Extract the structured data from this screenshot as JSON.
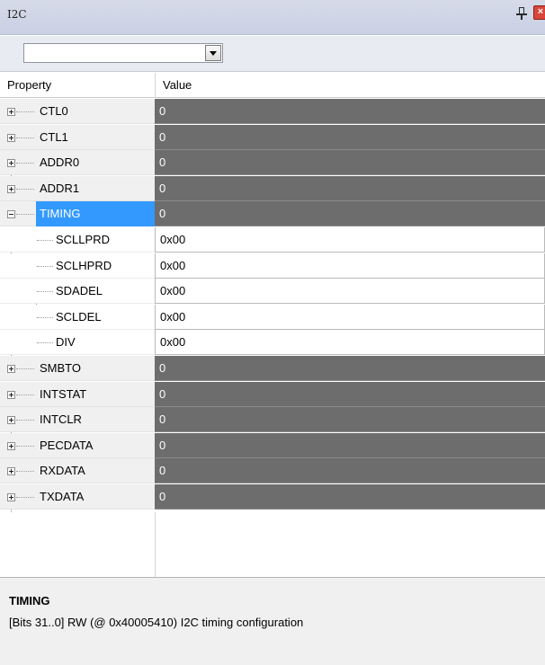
{
  "window": {
    "title": "I2C"
  },
  "combo": {
    "value": ""
  },
  "header": {
    "property": "Property",
    "value": "Value"
  },
  "rows_before": [
    {
      "name": "CTL0",
      "value": "0"
    },
    {
      "name": "CTL1",
      "value": "0"
    },
    {
      "name": "ADDR0",
      "value": "0"
    },
    {
      "name": "ADDR1",
      "value": "0"
    }
  ],
  "selected": {
    "name": "TIMING",
    "value": "0"
  },
  "fields": [
    {
      "name": "SCLLPRD",
      "value": "0x00"
    },
    {
      "name": "SCLHPRD",
      "value": "0x00"
    },
    {
      "name": "SDADEL",
      "value": "0x00"
    },
    {
      "name": "SCLDEL",
      "value": "0x00"
    },
    {
      "name": "DIV",
      "value": "0x00"
    }
  ],
  "rows_after": [
    {
      "name": "SMBTO",
      "value": "0"
    },
    {
      "name": "INTSTAT",
      "value": "0"
    },
    {
      "name": "INTCLR",
      "value": "0"
    },
    {
      "name": "PECDATA",
      "value": "0"
    },
    {
      "name": "RXDATA",
      "value": "0"
    },
    {
      "name": "TXDATA",
      "value": "0"
    }
  ],
  "description": {
    "title": "TIMING",
    "text": "[Bits 31..0] RW (@ 0x40005410) I2C timing configuration"
  },
  "icons": {
    "pin": "pin-icon",
    "close": "close-icon",
    "dropdown": "chevron-down-icon",
    "expand": "plus-box-icon",
    "collapse": "minus-box-icon"
  },
  "colors": {
    "selection": "#3399ff",
    "register_value_bg": "#6d6d6d",
    "titlebar": "#d6dbe9"
  }
}
